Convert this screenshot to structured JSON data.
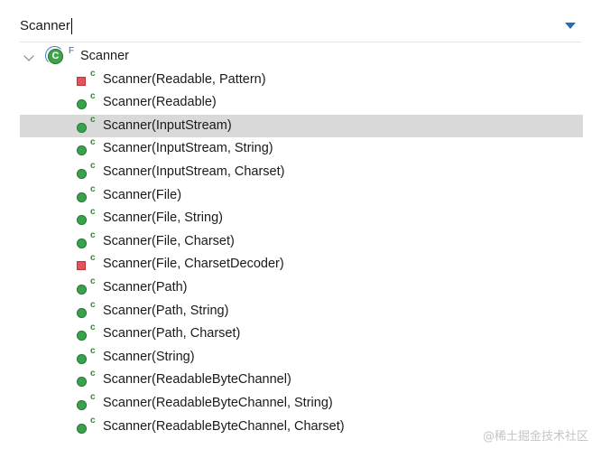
{
  "search": {
    "value": "Scanner"
  },
  "tree": {
    "root": {
      "label": "Scanner",
      "modifier": "F",
      "icon": "class-icon"
    },
    "constructor_badge": "c",
    "items": [
      {
        "label": "Scanner(Readable, Pattern)",
        "visibility": "private"
      },
      {
        "label": "Scanner(Readable)",
        "visibility": "public"
      },
      {
        "label": "Scanner(InputStream)",
        "visibility": "public",
        "selected": true
      },
      {
        "label": "Scanner(InputStream, String)",
        "visibility": "public"
      },
      {
        "label": "Scanner(InputStream, Charset)",
        "visibility": "public"
      },
      {
        "label": "Scanner(File)",
        "visibility": "public"
      },
      {
        "label": "Scanner(File, String)",
        "visibility": "public"
      },
      {
        "label": "Scanner(File, Charset)",
        "visibility": "public"
      },
      {
        "label": "Scanner(File, CharsetDecoder)",
        "visibility": "private"
      },
      {
        "label": "Scanner(Path)",
        "visibility": "public"
      },
      {
        "label": "Scanner(Path, String)",
        "visibility": "public"
      },
      {
        "label": "Scanner(Path, Charset)",
        "visibility": "public"
      },
      {
        "label": "Scanner(String)",
        "visibility": "public"
      },
      {
        "label": "Scanner(ReadableByteChannel)",
        "visibility": "public"
      },
      {
        "label": "Scanner(ReadableByteChannel, String)",
        "visibility": "public"
      },
      {
        "label": "Scanner(ReadableByteChannel, Charset)",
        "visibility": "public"
      }
    ]
  },
  "colors": {
    "public_dot": "#39a24d",
    "private_square": "#e8505a",
    "selection": "#d9d9d9",
    "dropdown_arrow": "#2a6bb8"
  },
  "watermark": "@稀土掘金技术社区"
}
